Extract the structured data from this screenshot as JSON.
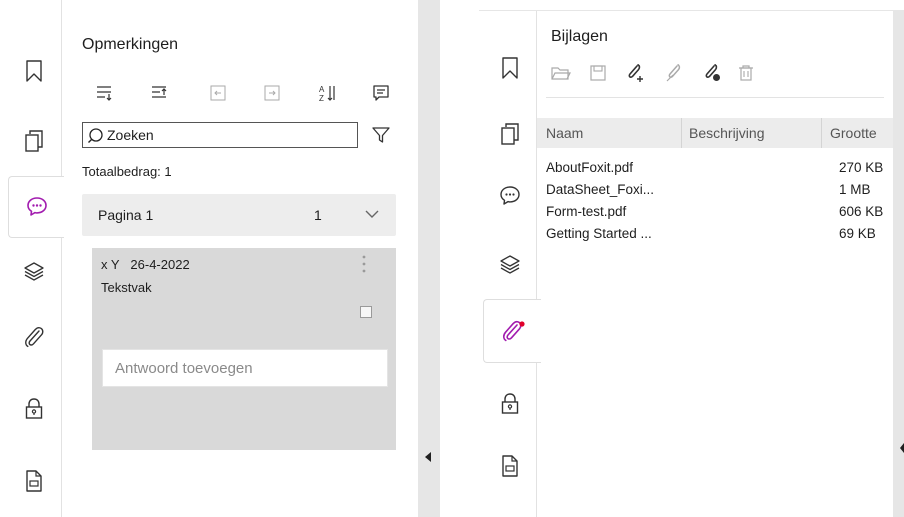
{
  "left": {
    "panel_title": "Opmerkingen",
    "search_placeholder": "Zoeken",
    "total_label": "Totaalbedrag: 1",
    "page_group": {
      "label": "Pagina 1",
      "count": "1"
    },
    "comment": {
      "author": "x Y",
      "date": "26-4-2022",
      "type": "Tekstvak",
      "reply_placeholder": "Antwoord toevoegen"
    },
    "rail_icons": [
      "bookmark-icon",
      "pages-icon",
      "comments-icon",
      "layers-icon",
      "attachment-icon",
      "security-icon",
      "file-icon"
    ],
    "active_rail": "comments-icon"
  },
  "right": {
    "panel_title": "Bijlagen",
    "toolbar_icons": [
      "open-folder-icon",
      "save-icon",
      "add-attachment-icon",
      "edit-attachment-icon",
      "delete-attachment-icon",
      "trash-icon"
    ],
    "columns": [
      "Naam",
      "Beschrijving",
      "Grootte"
    ],
    "rows": [
      {
        "name": "AboutFoxit.pdf",
        "description": "",
        "size": "270 KB"
      },
      {
        "name": "DataSheet_Foxi...",
        "description": "",
        "size": "1 MB"
      },
      {
        "name": "Form-test.pdf",
        "description": "",
        "size": "606 KB"
      },
      {
        "name": "Getting Started ...",
        "description": "",
        "size": "69 KB"
      }
    ],
    "active_rail": "attachment-icon"
  },
  "colors": {
    "accent": "#a21caf",
    "notification_dot": "#e0002a",
    "card_bg": "#d9d9d9"
  }
}
